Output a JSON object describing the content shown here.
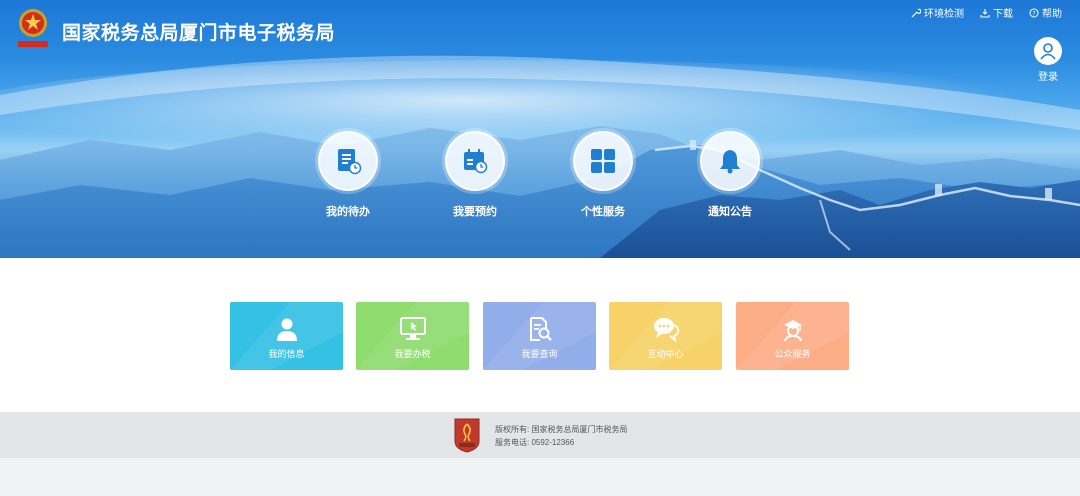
{
  "header": {
    "title": "国家税务总局厦门市电子税务局",
    "links": [
      {
        "label": "环境检测",
        "icon": "wrench-icon"
      },
      {
        "label": "下载",
        "icon": "download-icon"
      },
      {
        "label": "帮助",
        "icon": "help-icon"
      }
    ],
    "login_label": "登录"
  },
  "hero_nav": [
    {
      "label": "我的待办",
      "icon": "todo-document-icon"
    },
    {
      "label": "我要预约",
      "icon": "calendar-clock-icon"
    },
    {
      "label": "个性服务",
      "icon": "grid-icon"
    },
    {
      "label": "通知公告",
      "icon": "bell-icon"
    }
  ],
  "tiles": [
    {
      "label": "我的信息",
      "icon": "user-icon",
      "color": "#35c0e6"
    },
    {
      "label": "我要办税",
      "icon": "monitor-cursor-icon",
      "color": "#8fdc6f"
    },
    {
      "label": "我要查询",
      "icon": "document-search-icon",
      "color": "#92aeea"
    },
    {
      "label": "互动中心",
      "icon": "chat-icon",
      "color": "#f6d268"
    },
    {
      "label": "公众服务",
      "icon": "service-agent-icon",
      "color": "#fdad86"
    }
  ],
  "footer": {
    "copyright": "版权所有: 国家税务总局厦门市税务局",
    "phone": "服务电话: 0592-12366",
    "logo_label": "中国税务"
  },
  "colors": {
    "hero_blue": "#1e78d6",
    "icon_blue": "#1f7fd0"
  }
}
